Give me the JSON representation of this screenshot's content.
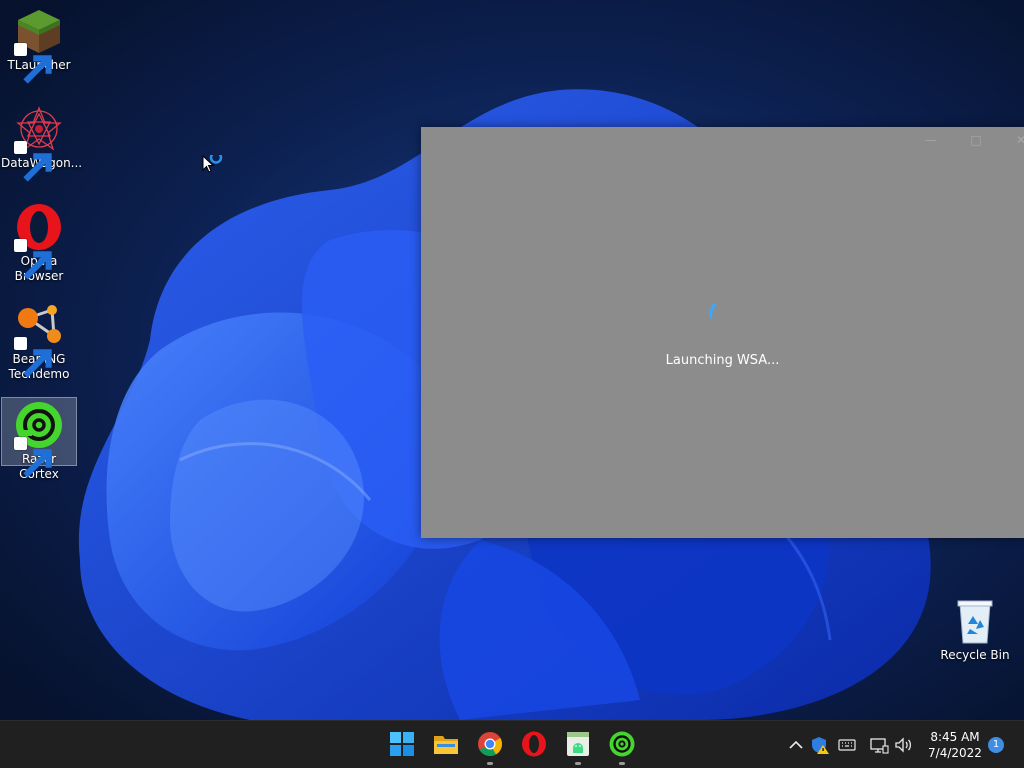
{
  "desktop": {
    "icons": [
      {
        "label": "TLauncher"
      },
      {
        "label": "DataWagon..."
      },
      {
        "label": "Opera Browser"
      },
      {
        "label": "BeamNG Techdemo"
      },
      {
        "label": "Razer Cortex"
      }
    ],
    "recycle_bin": {
      "label": "Recycle Bin"
    }
  },
  "wsa_window": {
    "status_text": "Launching WSA..."
  },
  "taskbar": {
    "apps": [
      {
        "icon": "windows-start-icon"
      },
      {
        "icon": "file-explorer-icon"
      },
      {
        "icon": "chrome-icon"
      },
      {
        "icon": "opera-icon"
      },
      {
        "icon": "android-wsa-icon"
      },
      {
        "icon": "razer-cortex-icon"
      }
    ],
    "tray": {
      "time": "8:45 AM",
      "date": "7/4/2022",
      "notification_count": "1"
    }
  },
  "colors": {
    "accent": "#3d8ee6",
    "taskbar": "#202020",
    "window": "#8c8c8c"
  }
}
